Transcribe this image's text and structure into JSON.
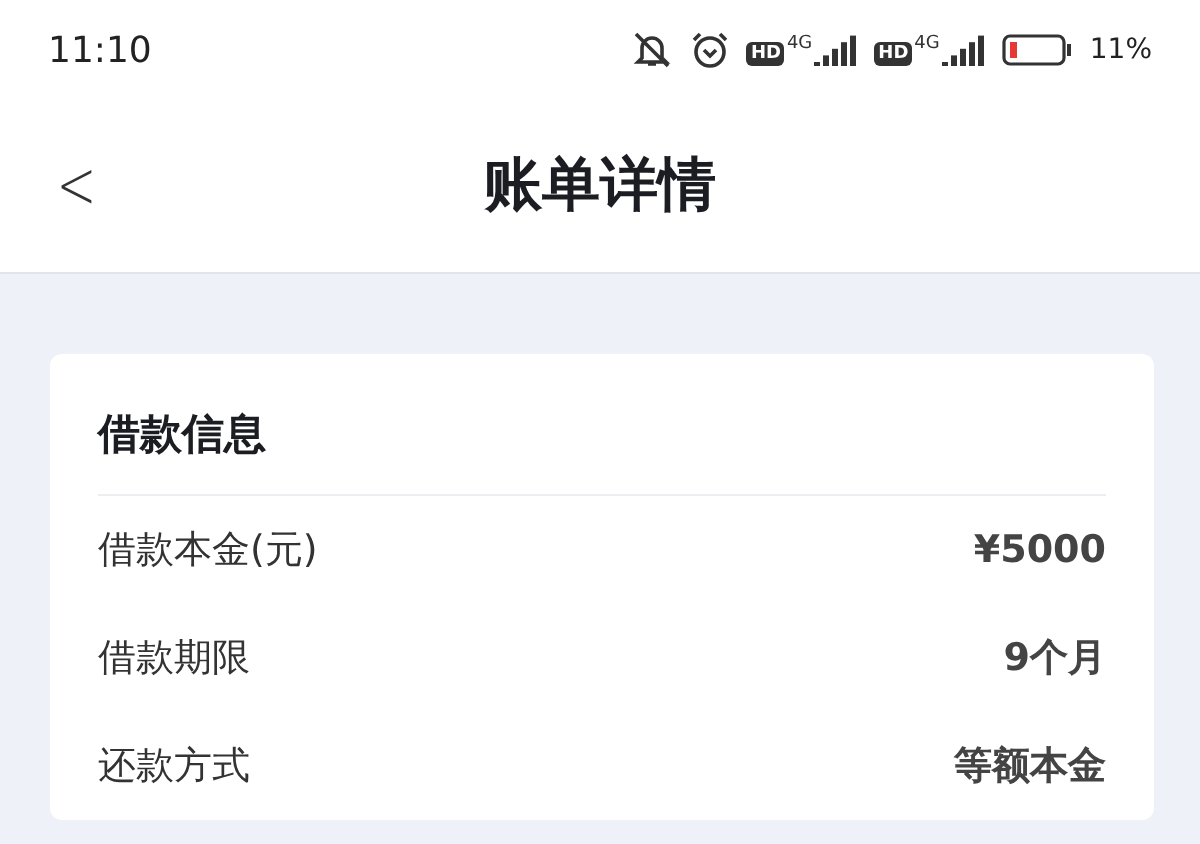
{
  "status_bar": {
    "time": "11:10",
    "networks": [
      {
        "badge": "HD",
        "type": "4G"
      },
      {
        "badge": "HD",
        "type": "4G"
      }
    ],
    "battery": "11%"
  },
  "header": {
    "back": "<",
    "title": "账单详情"
  },
  "card": {
    "title": "借款信息",
    "rows": [
      {
        "label": "借款本金(元)",
        "value": "¥5000"
      },
      {
        "label": "借款期限",
        "value": "9个月"
      },
      {
        "label": "还款方式",
        "value": "等额本金"
      }
    ]
  }
}
